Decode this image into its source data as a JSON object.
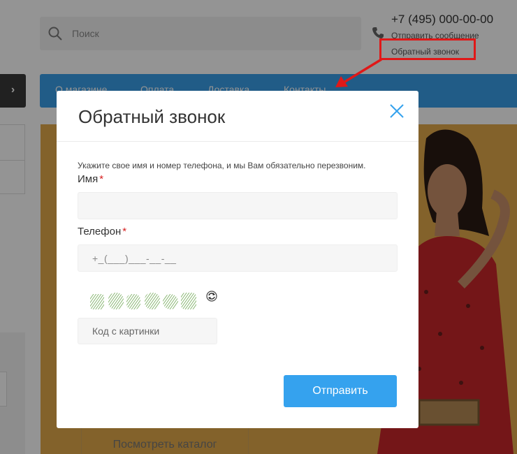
{
  "header": {
    "search_placeholder": "Поиск",
    "phone": "+7 (495) 000-00-00",
    "send_message": "Отправить сообщение",
    "callback": "Обратный звонок"
  },
  "nav": {
    "items": [
      {
        "label": "О магазине"
      },
      {
        "label": "Оплата"
      },
      {
        "label": "Доставка"
      },
      {
        "label": "Контакты"
      }
    ],
    "expand_glyph": "›"
  },
  "banner": {
    "catalog_button": "Посмотреть каталог"
  },
  "modal": {
    "title": "Обратный звонок",
    "intro": "Укажите свое имя и номер телефона, и мы Вам обязательно перезвоним.",
    "name_label": "Имя",
    "name_value": "",
    "phone_label": "Телефон",
    "phone_placeholder": "+_(___)___-__-__",
    "required_mark": "*",
    "captcha_placeholder": "Код с картинки",
    "submit_label": "Отправить"
  },
  "colors": {
    "accent": "#35a2ee",
    "nav": "#3a9fe8",
    "highlight": "#e01818",
    "banner": "#e2a94a"
  }
}
